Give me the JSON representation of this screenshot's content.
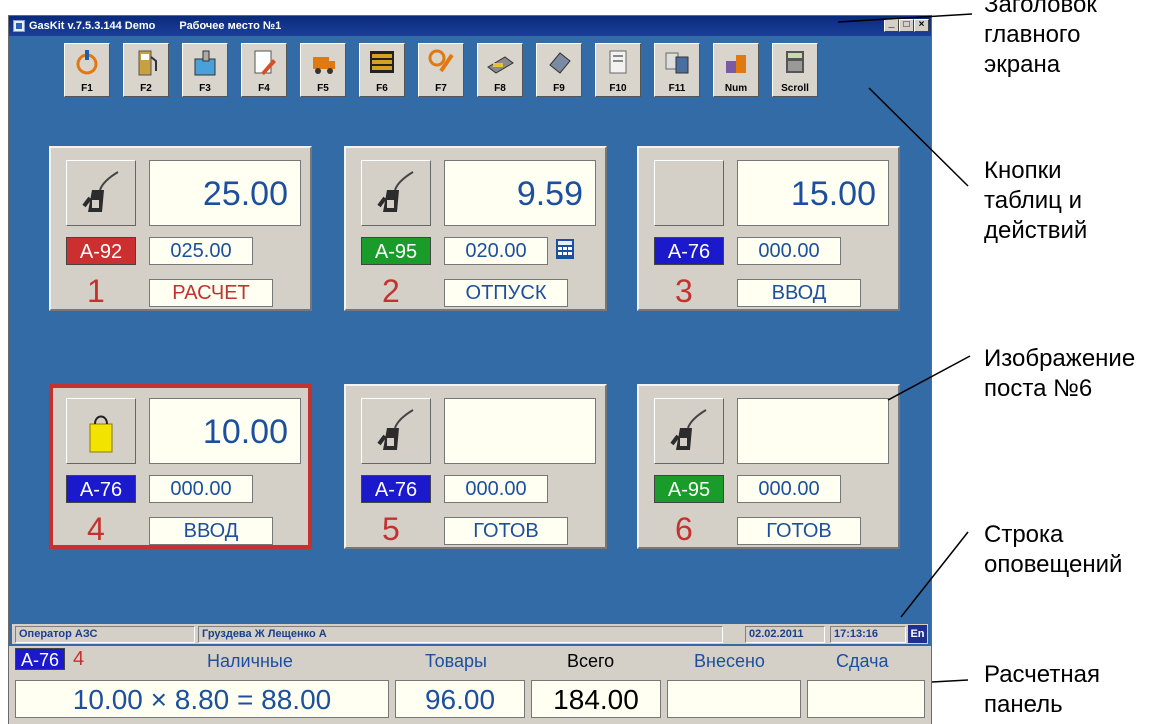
{
  "window": {
    "title": "GasKit v.7.5.3.144  Demo",
    "workplace": "Рабочее место №1",
    "controls": [
      "_",
      "□",
      "×"
    ]
  },
  "toolbar": [
    {
      "key": "F1",
      "icon": "power-icon"
    },
    {
      "key": "F2",
      "icon": "fuel-dispenser-icon"
    },
    {
      "key": "F3",
      "icon": "tank-icon"
    },
    {
      "key": "F4",
      "icon": "document-edit-icon"
    },
    {
      "key": "F5",
      "icon": "fuel-truck-icon"
    },
    {
      "key": "F6",
      "icon": "counters-icon"
    },
    {
      "key": "F7",
      "icon": "tools-icon"
    },
    {
      "key": "F8",
      "icon": "cash-icon"
    },
    {
      "key": "F9",
      "icon": "card-reader-icon"
    },
    {
      "key": "F10",
      "icon": "report-icon"
    },
    {
      "key": "F11",
      "icon": "reports-stack-icon"
    },
    {
      "key": "Num",
      "icon": "goods-icon"
    },
    {
      "key": "Scroll",
      "icon": "calculator-icon"
    }
  ],
  "pumps": [
    {
      "number": "1",
      "amount": "25.00",
      "fuel": "А-92",
      "fuel_color": "#cc2f2f",
      "volume": "025.00",
      "status": "РАСЧЕТ",
      "status_color": "red",
      "icon": "fuel-nozzle-icon"
    },
    {
      "number": "2",
      "amount": "9.59",
      "fuel": "А-95",
      "fuel_color": "#1a9c2a",
      "volume": "020.00",
      "status": "ОТПУСК",
      "status_color": "blue",
      "icon": "fuel-nozzle-icon",
      "extra_icon": "keypad-icon"
    },
    {
      "number": "3",
      "amount": "15.00",
      "fuel": "А-76",
      "fuel_color": "#1a1acc",
      "volume": "000.00",
      "status": "ВВОД",
      "status_color": "blue",
      "icon": "empty"
    },
    {
      "number": "4",
      "amount": "10.00",
      "fuel": "А-76",
      "fuel_color": "#1a1acc",
      "volume": "000.00",
      "status": "ВВОД",
      "status_color": "blue",
      "icon": "shopping-bag-icon",
      "selected": true
    },
    {
      "number": "5",
      "amount": "",
      "fuel": "А-76",
      "fuel_color": "#1a1acc",
      "volume": "000.00",
      "status": "ГОТОВ",
      "status_color": "blue",
      "icon": "fuel-nozzle-icon"
    },
    {
      "number": "6",
      "amount": "",
      "fuel": "А-95",
      "fuel_color": "#1a9c2a",
      "volume": "000.00",
      "status": "ГОТОВ",
      "status_color": "blue",
      "icon": "fuel-nozzle-icon"
    }
  ],
  "statusline": {
    "role": "Оператор АЗС",
    "operators": "Груздева Ж Лещенко А",
    "date": "02.02.2011",
    "time": "17:13:16",
    "lang": "En"
  },
  "payment": {
    "fuel": "А-76",
    "pump": "4",
    "headers": {
      "cash": "Наличные",
      "goods": "Товары",
      "total": "Всего",
      "paid": "Внесено",
      "change": "Сдача"
    },
    "formula": "10.00 × 8.80 = 88.00",
    "goods": "96.00",
    "total": "184.00",
    "paid": "",
    "change": ""
  },
  "annotations": {
    "title_bar": "Заголовок\nглавного\nэкрана",
    "buttons": "Кнопки\nтаблиц и\nдействий",
    "pump6": "Изображение\nпоста №6",
    "notify": "Строка\nоповещений",
    "payment": "Расчетная\nпанель"
  },
  "colors": {
    "background": "#336ba6",
    "accent_red": "#c3322e",
    "text_blue": "#1c4f9e"
  }
}
